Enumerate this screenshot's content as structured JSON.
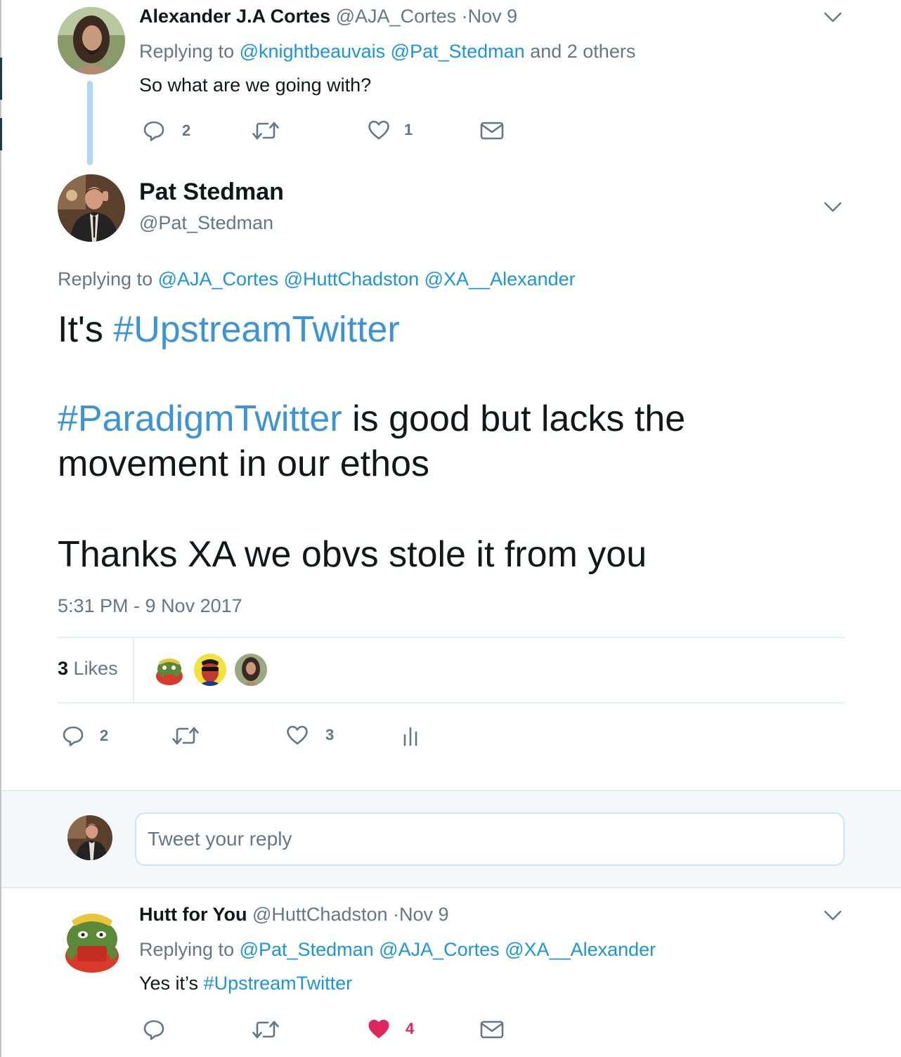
{
  "tweet1": {
    "name": "Alexander J.A Cortes",
    "handle": "@AJA_Cortes",
    "date": "·Nov 9",
    "replying_prefix": "Replying to",
    "mentions": [
      "@knightbeauvais",
      "@Pat_Stedman"
    ],
    "replying_suffix": "and 2 others",
    "text": "So what are we going with?",
    "reply_count": "2",
    "like_count": "1"
  },
  "main_tweet": {
    "name": "Pat Stedman",
    "handle": "@Pat_Stedman",
    "replying_prefix": "Replying to",
    "mentions": [
      "@AJA_Cortes",
      "@HuttChadston",
      "@XA__Alexander"
    ],
    "line1_prefix": "It's",
    "hashtag1": "#UpstreamTwitter",
    "hashtag2": "#ParadigmTwitter",
    "line2_rest": "is good but lacks the",
    "line3": "movement in our ethos",
    "line4": "Thanks XA we obvs stole it from you",
    "timestamp": "5:31 PM - 9 Nov 2017",
    "likes_number": "3",
    "likes_label": "Likes",
    "reply_count": "2",
    "like_count": "3"
  },
  "reply_input": {
    "placeholder": "Tweet your reply"
  },
  "tweet3": {
    "name": "Hutt for You",
    "handle": "@HuttChadston",
    "date": "·Nov 9",
    "replying_prefix": "Replying to",
    "mentions": [
      "@Pat_Stedman",
      "@AJA_Cortes",
      "@XA__Alexander"
    ],
    "text_prefix": "Yes it’s",
    "hashtag": "#UpstreamTwitter",
    "like_count": "4"
  },
  "colors": {
    "link": "#1b95e0",
    "muted": "#657786",
    "liked": "#e0245e",
    "thread": "#aed7f1"
  },
  "icons": [
    "reply-icon",
    "retweet-icon",
    "heart-icon",
    "mail-icon",
    "analytics-icon",
    "chevron-down-icon"
  ]
}
